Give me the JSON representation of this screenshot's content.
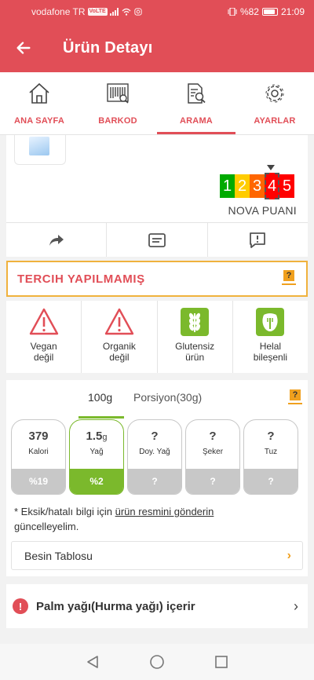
{
  "status_bar": {
    "carrier": "vodafone TR",
    "volte": "VoLTE",
    "battery": "%82",
    "time": "21:09"
  },
  "app_bar": {
    "title": "Ürün Detayı",
    "back_icon": "arrow-left-icon"
  },
  "tabs": [
    {
      "label": "ANA SAYFA",
      "icon": "home-icon"
    },
    {
      "label": "BARKOD",
      "icon": "barcode-icon"
    },
    {
      "label": "ARAMA",
      "icon": "search-document-icon",
      "active": true
    },
    {
      "label": "AYARLAR",
      "icon": "gear-icon"
    }
  ],
  "nova": {
    "scale": [
      "1",
      "2",
      "3",
      "4",
      "5"
    ],
    "value": 4,
    "label": "NOVA PUANI"
  },
  "actions": [
    "share-icon",
    "list-icon",
    "feedback-icon"
  ],
  "preference": {
    "label": "TERCIH YAPILMAMIŞ"
  },
  "badges": [
    {
      "line1": "Vegan",
      "line2": "değil",
      "icon": "warning-icon"
    },
    {
      "line1": "Organik",
      "line2": "değil",
      "icon": "warning-icon"
    },
    {
      "line1": "Glutensiz",
      "line2": "ürün",
      "icon": "wheat-icon"
    },
    {
      "line1": "Helal",
      "line2": "bileşenli",
      "icon": "helal-icon"
    }
  ],
  "portion": {
    "tab1": "100g",
    "tab2": "Porsiyon(30g)"
  },
  "nutrients": [
    {
      "value": "379",
      "unit": "",
      "name": "Kalori",
      "percent": "%19"
    },
    {
      "value": "1.5",
      "unit": "g",
      "name": "Yağ",
      "percent": "%2"
    },
    {
      "value": "?",
      "unit": "",
      "name": "Doy. Yağ",
      "percent": "?"
    },
    {
      "value": "?",
      "unit": "",
      "name": "Şeker",
      "percent": "?"
    },
    {
      "value": "?",
      "unit": "",
      "name": "Tuz",
      "percent": "?"
    }
  ],
  "note": {
    "prefix": "* Eksik/hatalı bilgi için ",
    "link": "ürün resmini gönderin",
    "suffix": "güncelleyelim."
  },
  "besin": {
    "label": "Besin Tablosu"
  },
  "warning": {
    "text": "Palm yağı(Hurma yağı) içerir"
  },
  "colors": {
    "primary": "#e14e57",
    "accent": "#f0a01e",
    "green": "#7bb92c"
  }
}
